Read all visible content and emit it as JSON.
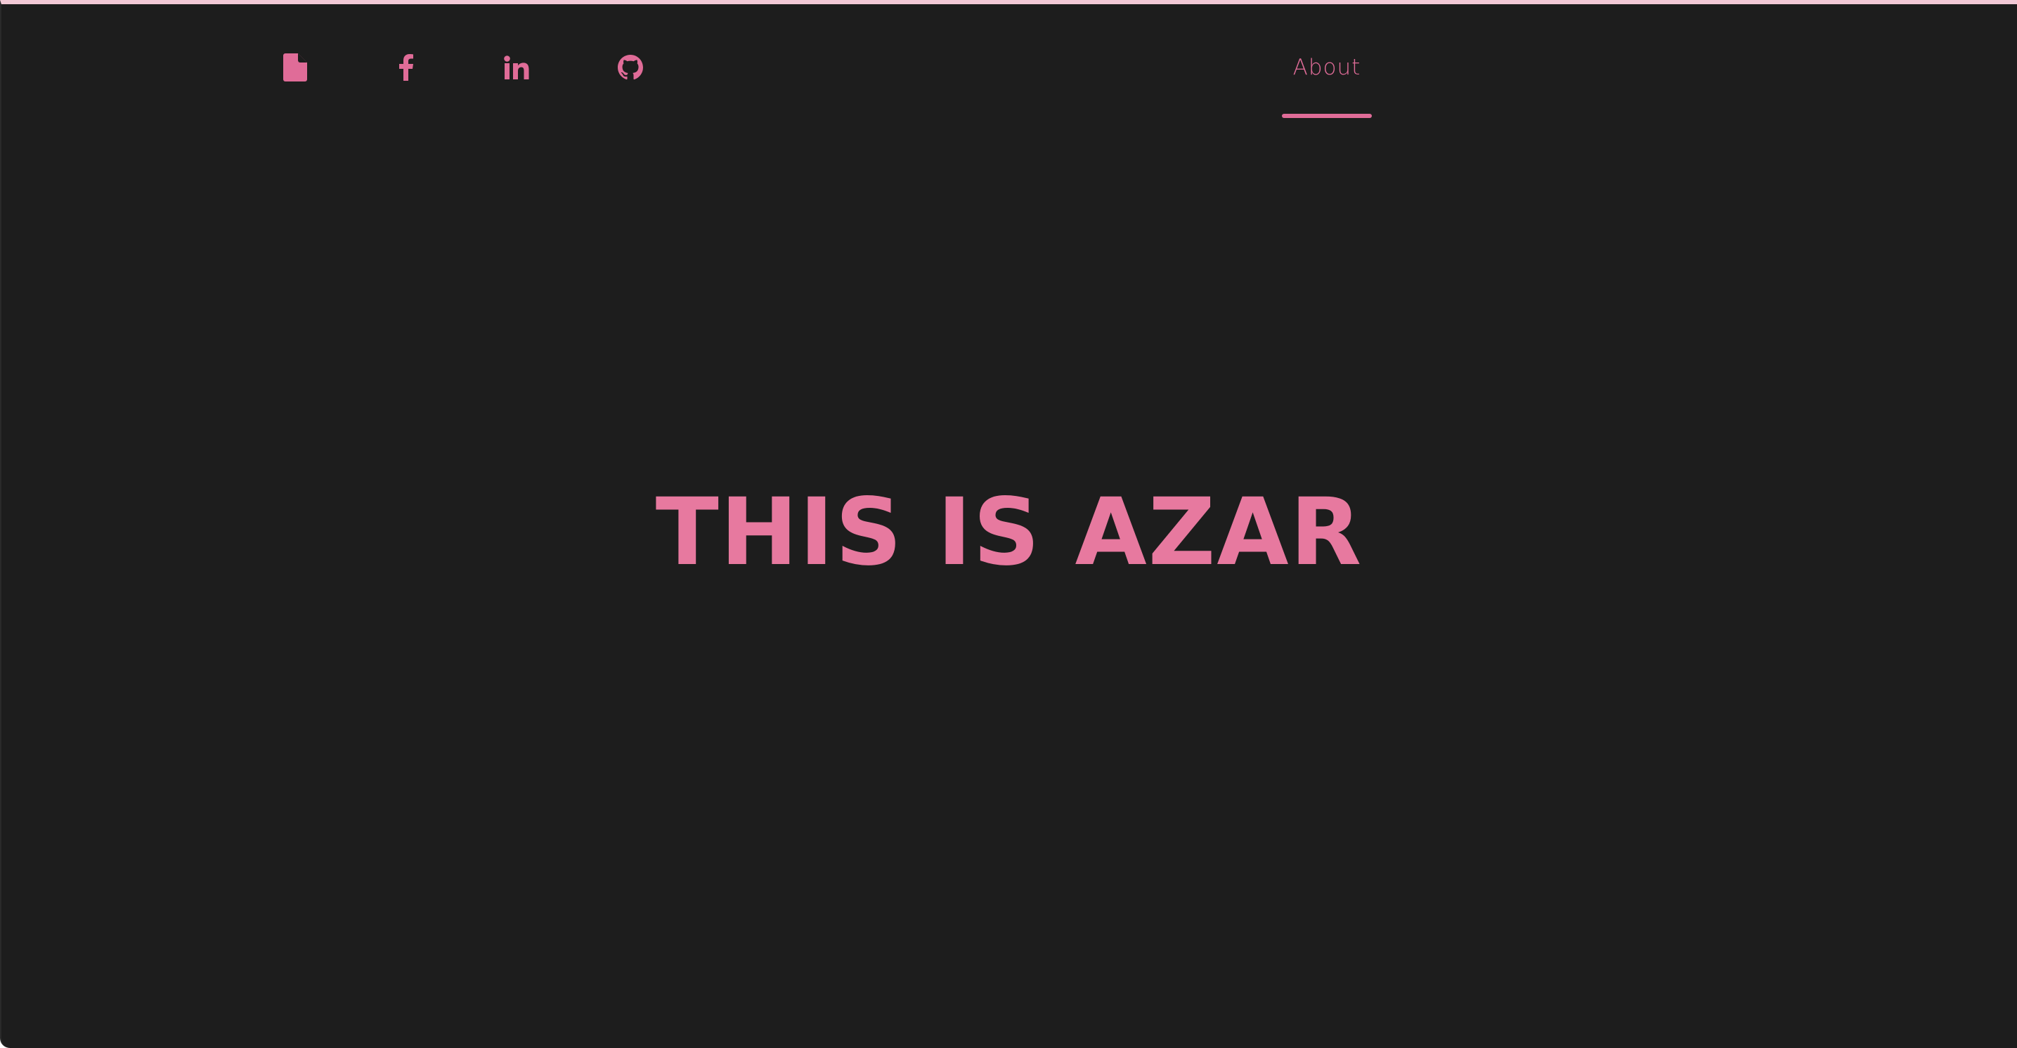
{
  "colors": {
    "background": "#1d1d1d",
    "accent": "#e06c98",
    "heading": "#e7799f",
    "top_border": "#f2c9d6"
  },
  "header": {
    "social_icons": [
      {
        "icon": "file-icon",
        "label": "Resume"
      },
      {
        "icon": "facebook-icon",
        "label": "Facebook"
      },
      {
        "icon": "linkedin-icon",
        "label": "LinkedIn"
      },
      {
        "icon": "github-icon",
        "label": "GitHub"
      }
    ],
    "nav": {
      "about_label": "About",
      "active": "About"
    }
  },
  "hero": {
    "title": "THIS IS AZAR"
  }
}
